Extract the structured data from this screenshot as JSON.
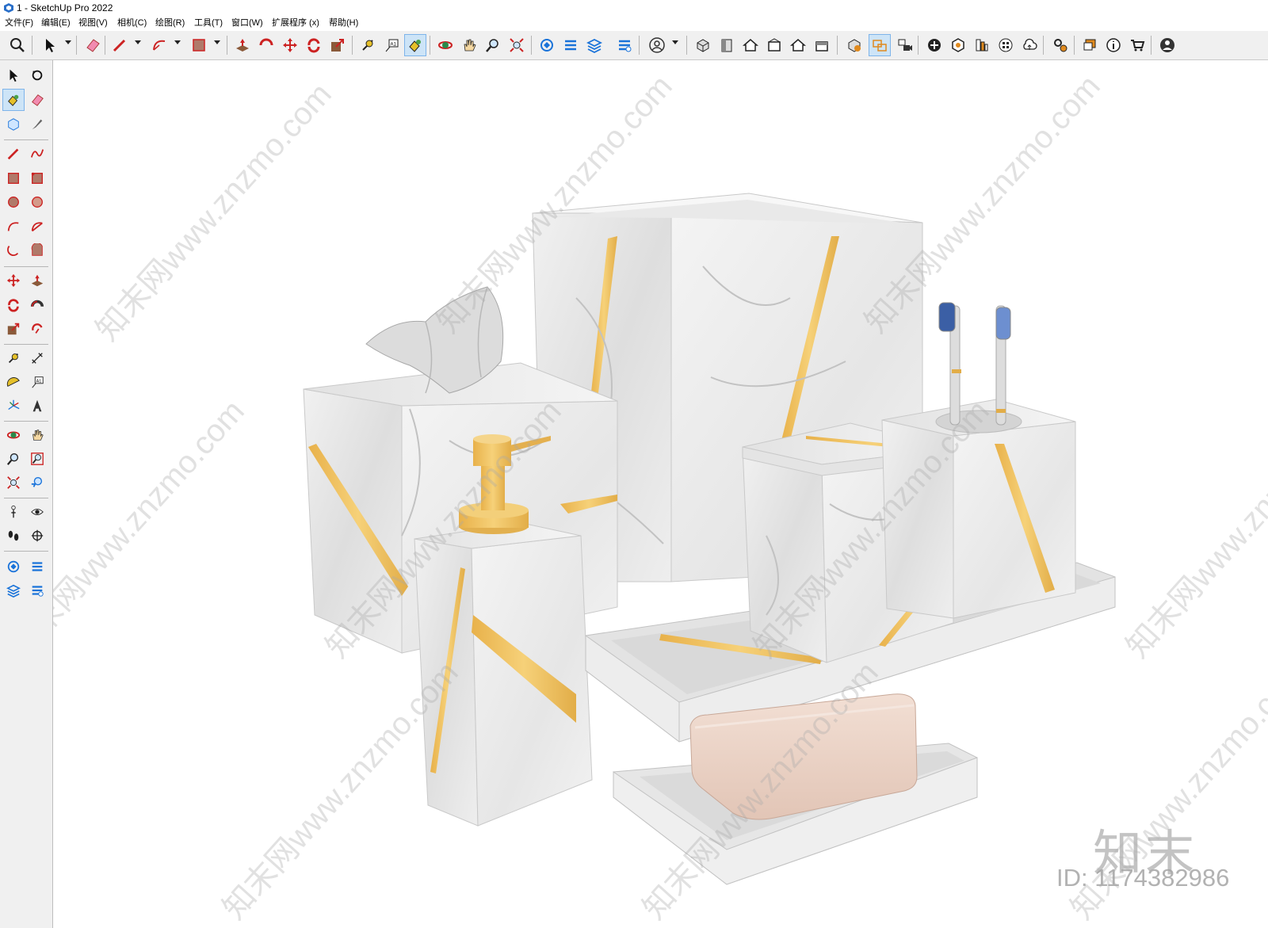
{
  "window": {
    "title": "1 - SketchUp Pro 2022"
  },
  "menu": [
    "文件(F)",
    "编辑(E)",
    "视图(V)",
    "相机(C)",
    "绘图(R)",
    "工具(T)",
    "窗口(W)",
    "扩展程序 (x)",
    "帮助(H)"
  ],
  "toolbar": {
    "icons": [
      "search-icon",
      "select-icon",
      "eraser-icon",
      "pencil-icon",
      "arc-icon",
      "rectangle-icon",
      "pushpull-icon",
      "followme-icon",
      "move-icon",
      "rotate-icon",
      "scale-icon",
      "tape-icon",
      "text-icon",
      "paint-icon",
      "orbit-icon",
      "pan-icon",
      "zoom-icon",
      "zoom-extents-icon",
      "warehouse-icon",
      "components-icon",
      "layers-icon",
      "sandbox-icon",
      "profile-icon",
      "iso-view-icon",
      "top-view-icon",
      "front-view-icon",
      "right-view-icon",
      "back-view-icon",
      "left-view-icon",
      "section-icon",
      "display-section-icon",
      "scene-camera-icon",
      "add-icon",
      "solid-icon",
      "style-icon",
      "shadow-icon",
      "cloud-icon",
      "settings-icon",
      "message-icon",
      "info-icon",
      "cart-icon",
      "user-icon"
    ],
    "active": "paint-icon"
  },
  "left_toolbar": {
    "icons": [
      "select-icon",
      "orbit-icon",
      "paint-icon",
      "eraser-icon",
      "component-icon",
      "tag-icon",
      "line-icon",
      "freehand-icon",
      "rectangle-icon",
      "rotated-rectangle-icon",
      "circle-icon",
      "polygon-icon",
      "arc-icon",
      "pie-icon",
      "two-point-arc-icon",
      "three-point-arc-icon",
      "move-icon",
      "pushpull-icon",
      "rotate-icon",
      "followme-icon",
      "scale-icon",
      "offset-icon",
      "tape-icon",
      "dimension-icon",
      "protractor-icon",
      "text-icon",
      "axes-icon",
      "3dtext-icon",
      "orbit2-icon",
      "pan-icon",
      "zoom-icon",
      "zoom-window-icon",
      "zoom-extents-icon",
      "previous-view-icon",
      "position-camera-icon",
      "look-around-icon",
      "walk-icon",
      "section-plane-icon",
      "warehouse-icon",
      "extension-warehouse-icon",
      "layout-icon",
      "extension-manager-icon"
    ],
    "active": "paint-icon"
  },
  "viewport": {
    "watermark_text": "知末网www.znzmo.com",
    "brand": "知末",
    "image_id": "ID: 1174382986"
  },
  "colors": {
    "gold": "#efbd5c",
    "marble": "#ececec",
    "marble_shade": "#d8d8d8",
    "soap": "#ead3c6",
    "accent": "#1a73d9"
  }
}
